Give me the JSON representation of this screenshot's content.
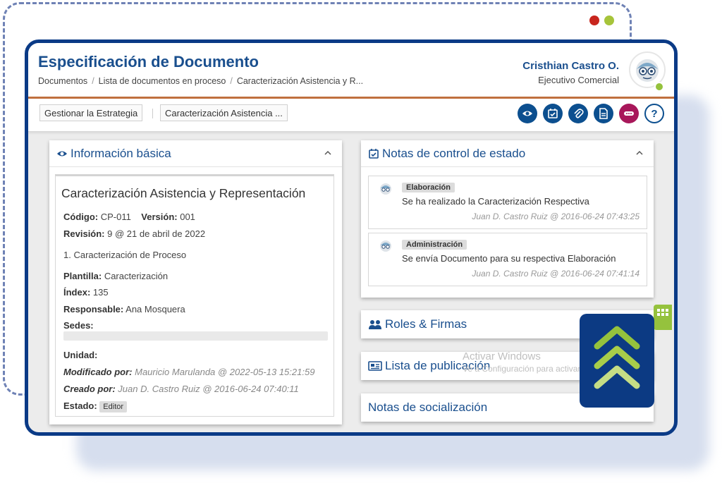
{
  "window": {
    "title": "Especificación de Documento",
    "breadcrumb": [
      "Documentos",
      "Lista de documentos en proceso",
      "Caracterización Asistencia y R..."
    ],
    "breadcrumb_sep": "/"
  },
  "user": {
    "name": "Cristhian Castro O.",
    "role": "Ejecutivo Comercial"
  },
  "toolbar": {
    "buttons": [
      {
        "label": "Gestionar la Estrategia"
      },
      {
        "label": "Caracterización Asistencia ..."
      }
    ],
    "icons": [
      "eye-icon",
      "calendar-check-icon",
      "paperclip-icon",
      "document-icon",
      "more-icon",
      "help-icon"
    ],
    "help_label": "?"
  },
  "info_panel": {
    "title": "Información básica",
    "doc_title": "Caracterización Asistencia y Representación",
    "fields": {
      "codigo_label": "Código:",
      "codigo": "CP-011",
      "version_label": "Versión:",
      "version": "001",
      "revision_label": "Revisión:",
      "revision": "9 @ 21 de abril de 2022",
      "proceso": "1. Caracterización de Proceso",
      "plantilla_label": "Plantilla:",
      "plantilla": "Caracterización",
      "index_label": "Índex:",
      "index": "135",
      "responsable_label": "Responsable:",
      "responsable": "Ana Mosquera",
      "sedes_label": "Sedes:",
      "unidad_label": "Unidad:",
      "modificado_label": "Modificado por:",
      "modificado": "Mauricio Marulanda @ 2022-05-13 15:21:59",
      "creado_label": "Creado por:",
      "creado": "Juan D. Castro Ruiz @ 2016-06-24 07:40:11",
      "estado_label": "Estado:",
      "estado": "Editor"
    }
  },
  "notes_panel": {
    "title": "Notas de control de estado",
    "notes": [
      {
        "badge": "Elaboración",
        "text": "Se ha realizado la Caracterización Respectiva",
        "meta": "Juan D. Castro Ruiz @ 2016-06-24 07:43:25"
      },
      {
        "badge": "Administración",
        "text": "Se envía Documento para su respectiva Elaboración",
        "meta": "Juan D. Castro Ruiz @ 2016-06-24 07:41:14"
      }
    ]
  },
  "sections": {
    "roles": "Roles & Firmas",
    "publicacion": "Lista de publicación",
    "socializacion": "Notas de socialización"
  },
  "watermark": {
    "line1": "Activar Windows",
    "line2": "Ve a Configuración para activar Windows."
  },
  "colors": {
    "brand_blue": "#0a3a86",
    "title_blue": "#1a4f8e",
    "accent_green": "#95c23d",
    "accent_orange": "#c0703e",
    "accent_pink": "#a8175a",
    "dot_red": "#c8261e",
    "dot_green": "#95c23d"
  }
}
